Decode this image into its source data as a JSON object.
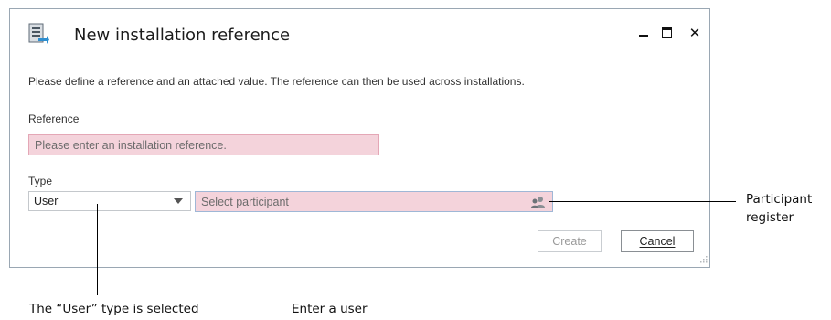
{
  "window": {
    "title": "New installation reference",
    "description": "Please define a reference and an attached value. The reference can then be used across installations."
  },
  "form": {
    "reference_label": "Reference",
    "reference_placeholder": "Please enter an installation reference.",
    "type_label": "Type",
    "type_selected": "User",
    "participant_placeholder": "Select participant"
  },
  "buttons": {
    "create": "Create",
    "cancel": "Cancel"
  },
  "annotations": {
    "participant_register_line1": "Participant",
    "participant_register_line2": "register",
    "user_type_selected": "The “User” type is selected",
    "enter_user": "Enter a user"
  },
  "colors": {
    "required_field_bg": "#f4d3db",
    "required_field_border": "#e4a7b6"
  }
}
